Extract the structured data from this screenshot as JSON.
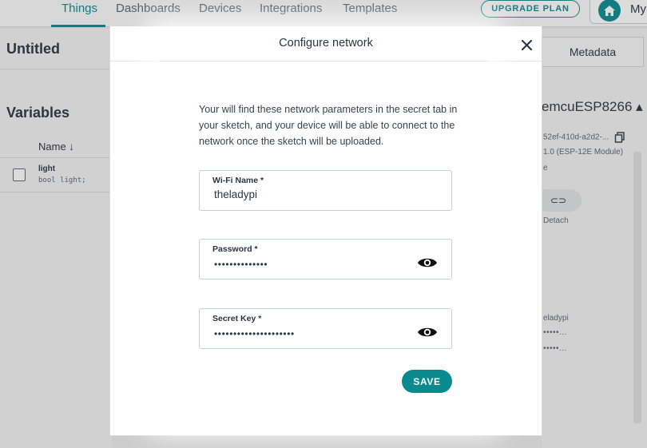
{
  "nav": {
    "items": [
      "Things",
      "Dashboards",
      "Devices",
      "Integrations",
      "Templates"
    ],
    "active": "Things",
    "upgrade_label": "UPGRADE PLAN",
    "profile_label": "My"
  },
  "thing": {
    "title": "Untitled",
    "variables_title": "Variables",
    "name_column": "Name ↓",
    "variable": {
      "name": "light",
      "declaration": "bool light;"
    }
  },
  "side": {
    "metadata_tab": "Metadata",
    "device_name": "emcuESP8266 ▴",
    "device_id": "52ef-410d-a2d2-...",
    "device_type": "1.0 (ESP-12E Module)",
    "device_e": "e",
    "detach_icon": "⊂⊃",
    "detach_label": "Detach",
    "network_ssid": "eladypi",
    "network_dots_1": "•••••...",
    "network_dots_2": "•••••..."
  },
  "modal": {
    "title": "Configure network",
    "close_icon": "×",
    "description": "Your will find these network parameters in the secret tab in your sketch, and your device will be able to connect to the network once the sketch will be uploaded.",
    "wifi_label": "Wi-Fi Name *",
    "wifi_value": "theladypi",
    "password_label": "Password *",
    "password_mask": "••••••••••••••",
    "secret_label": "Secret Key *",
    "secret_mask": "•••••••••••••••••••••",
    "save_label": "SAVE"
  },
  "colors": {
    "accent": "#0a8a8f",
    "text": "#2b3440"
  }
}
